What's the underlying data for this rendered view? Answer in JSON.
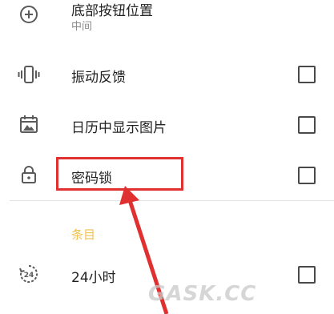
{
  "settings": {
    "bottom_button_position": {
      "title": "底部按钮位置",
      "subtitle": "中间",
      "icon": "plus-circle-icon"
    },
    "vibration_feedback": {
      "title": "振动反馈",
      "icon": "vibration-icon",
      "checked": false
    },
    "calendar_show_images": {
      "title": "日历中显示图片",
      "icon": "calendar-image-icon",
      "checked": false
    },
    "password_lock": {
      "title": "密码锁",
      "icon": "lock-icon",
      "checked": false
    },
    "entries_section": {
      "header": "条目"
    },
    "time_24h": {
      "title": "24小时",
      "icon": "24h-clock-icon",
      "checked": false
    }
  },
  "annotation": {
    "color": "#e03030",
    "highlight_target": "password_lock"
  },
  "watermark": {
    "text": "GASK.CC"
  },
  "colors": {
    "section_header": "#f2c14e",
    "text_primary": "#222222",
    "text_secondary": "#8a8a8a",
    "icon": "#5a5a5a"
  }
}
